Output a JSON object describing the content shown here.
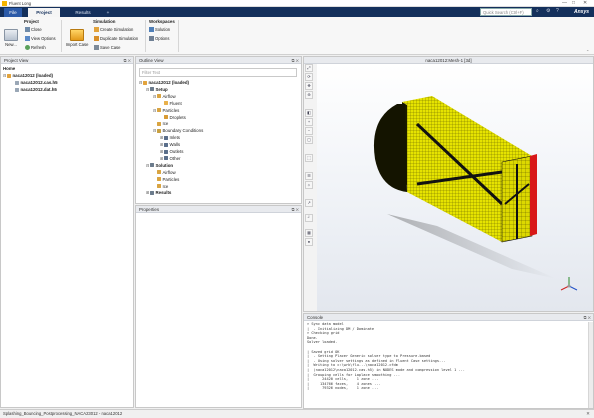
{
  "window": {
    "title": "Fluent Long"
  },
  "tabs": {
    "file": "File",
    "project": "Project",
    "results": "Results",
    "add": "+"
  },
  "search": {
    "placeholder": "Quick Search (Ctrl+F)"
  },
  "brand": "Ansys",
  "ribbon": {
    "project_group": "Project",
    "new_label": "New...",
    "close_label": "Close",
    "view_options_label": "View Options",
    "refresh_label": "Refresh",
    "simulation_group": "Simulation",
    "import_case_label": "Import Case",
    "create_simulation_label": "Create Simulation",
    "duplicate_simulation_label": "Duplicate Simulation",
    "save_case_label": "Save Case",
    "workspaces_group": "Workspaces",
    "solution_label": "Solution",
    "options_label": "Options"
  },
  "project_view": {
    "title": "Project View",
    "home": "Home",
    "root": "naca12012 (loaded)",
    "files": [
      "naca12012.cas.h5",
      "naca12012.dat.h5"
    ]
  },
  "outline_view": {
    "title": "Outline View",
    "filter_placeholder": "Filter Text",
    "items": [
      {
        "label": "naca12012 (loaded)",
        "level": 0,
        "toggle": "⊟",
        "icon": "case-icon",
        "color": "#e2a33c",
        "bold": true
      },
      {
        "label": "Setup",
        "level": 1,
        "toggle": "⊟",
        "icon": "setup-icon",
        "color": "#6b7b8c",
        "bold": true
      },
      {
        "label": "Airflow",
        "level": 2,
        "toggle": "⊟",
        "icon": "airflow-icon",
        "color": "#d9a441",
        "bold": false
      },
      {
        "label": "Fluent",
        "level": 3,
        "toggle": "",
        "icon": "fluent-icon",
        "color": "#e8b04a",
        "bold": false
      },
      {
        "label": "Particles",
        "level": 2,
        "toggle": "⊟",
        "icon": "particles-icon",
        "color": "#d9a441",
        "bold": false
      },
      {
        "label": "Droplets",
        "level": 3,
        "toggle": "",
        "icon": "droplets-icon",
        "color": "#d89a33",
        "bold": false
      },
      {
        "label": "Ice",
        "level": 2,
        "toggle": "",
        "icon": "ice-icon",
        "color": "#d9a441",
        "bold": false
      },
      {
        "label": "Boundary Conditions",
        "level": 2,
        "toggle": "⊟",
        "icon": "boundary-icon",
        "color": "#c8a040",
        "bold": false
      },
      {
        "label": "Inlets",
        "level": 3,
        "toggle": "⊞",
        "icon": "inlets-icon",
        "color": "#5a6e8a",
        "bold": false
      },
      {
        "label": "Walls",
        "level": 3,
        "toggle": "⊞",
        "icon": "walls-icon",
        "color": "#5a6e8a",
        "bold": false
      },
      {
        "label": "Outlets",
        "level": 3,
        "toggle": "⊞",
        "icon": "outlets-icon",
        "color": "#5a6e8a",
        "bold": false
      },
      {
        "label": "Other",
        "level": 3,
        "toggle": "⊞",
        "icon": "other-icon",
        "color": "#5a6e8a",
        "bold": false
      },
      {
        "label": "Solution",
        "level": 1,
        "toggle": "⊟",
        "icon": "solution-icon",
        "color": "#6b7b8c",
        "bold": true
      },
      {
        "label": "Airflow",
        "level": 2,
        "toggle": "",
        "icon": "airflow-icon",
        "color": "#d9a441",
        "bold": false
      },
      {
        "label": "Particles",
        "level": 2,
        "toggle": "",
        "icon": "particles-icon",
        "color": "#d9a441",
        "bold": false
      },
      {
        "label": "Ice",
        "level": 2,
        "toggle": "",
        "icon": "ice-icon",
        "color": "#d9a441",
        "bold": false
      },
      {
        "label": "Results",
        "level": 1,
        "toggle": "⊞",
        "icon": "results-icon",
        "color": "#6b7b8c",
        "bold": true
      }
    ]
  },
  "properties": {
    "title": "Properties"
  },
  "graphics": {
    "title": "naca12012:Mesh-1 [3d]"
  },
  "console": {
    "title": "Console",
    "lines": [
      "> Sync data model",
      "|  - Initializing DM / Dominate",
      "> Checking grid",
      "Done.",
      "Solver loaded.",
      "",
      "| Saved grid OK",
      "|  - Setting Placer Generic solver type to Pressure-based",
      "|  - Using solver settings as defined in Fluent Case settings...",
      "|  Writing to c:\\wrk\\flu...\\naca12012.cfdm",
      "|  (naca12012\\naca12012.cas.h5) in NODES mode and compression level 1 ...",
      "|  Grouping cells for Laplace smoothing ...",
      "|      24420 cells,    1 zone ...",
      "|     134766 faces,    4 zones ...",
      "|      79326 nodes,    1 zone ..."
    ]
  },
  "status": {
    "text": "Splashing_Bouncing_Postprocessing_NACA23012 - naca12012"
  },
  "colors": {
    "accent": "#14305c",
    "mesh_yellow": "#e4e000",
    "inlet_red": "#d81818"
  }
}
